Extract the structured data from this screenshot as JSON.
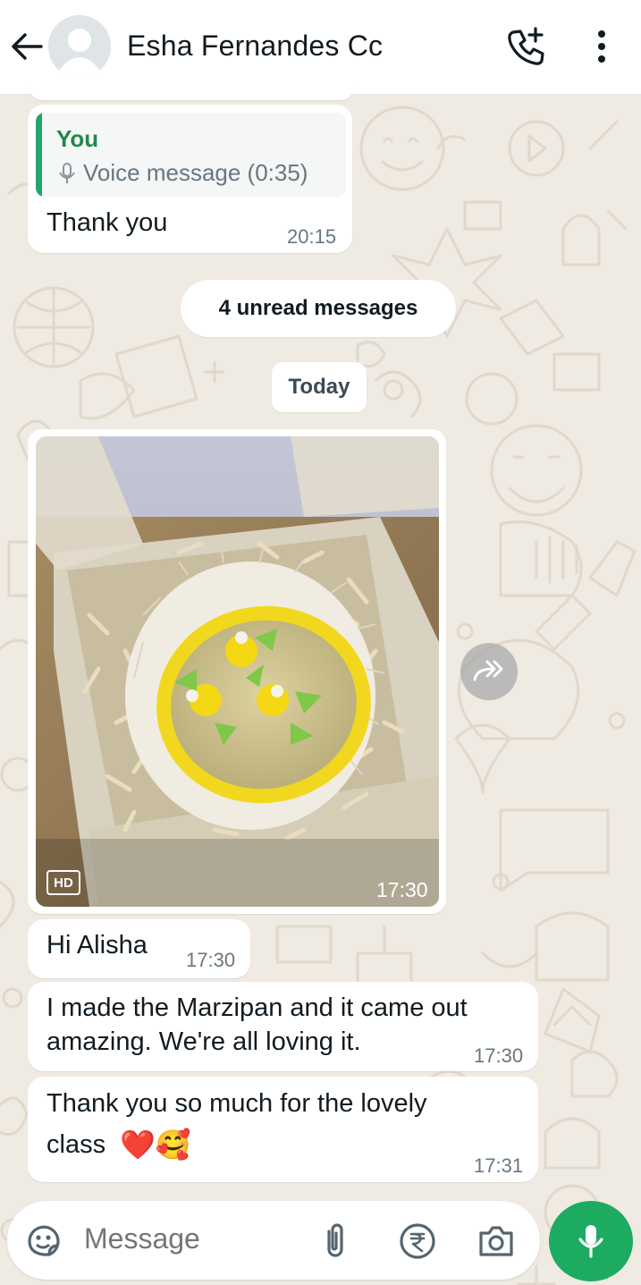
{
  "header": {
    "contact_name": "Esha Fernandes Cc",
    "icons": [
      "back-arrow-icon",
      "avatar",
      "add-call-icon",
      "more-vert-icon"
    ]
  },
  "messages": {
    "reply": {
      "quote_author": "You",
      "quote_text": "Voice message (0:35)",
      "text": "Thank you",
      "time": "20:15"
    },
    "unread_banner": "4 unread messages",
    "date_divider": "Today",
    "photo": {
      "badge": "HD",
      "time": "17:30"
    },
    "incoming": [
      {
        "text": "Hi Alisha",
        "time": "17:30"
      },
      {
        "line1": "I made the Marzipan and it came out",
        "line2": "amazing. We're all loving it.",
        "time": "17:30"
      },
      {
        "line1": "Thank you so much for the lovely",
        "line2": "class",
        "emoji": "❤️🥰",
        "time": "17:31"
      }
    ]
  },
  "composer": {
    "placeholder": "Message",
    "icons": [
      "sticker-icon",
      "attach-icon",
      "rupee-payment-icon",
      "camera-icon",
      "mic-icon"
    ]
  },
  "colors": {
    "accent_green": "#1daa61",
    "quote_author": "#1f8a4c",
    "wallpaper": "#efeae2",
    "bubble": "#ffffff"
  }
}
